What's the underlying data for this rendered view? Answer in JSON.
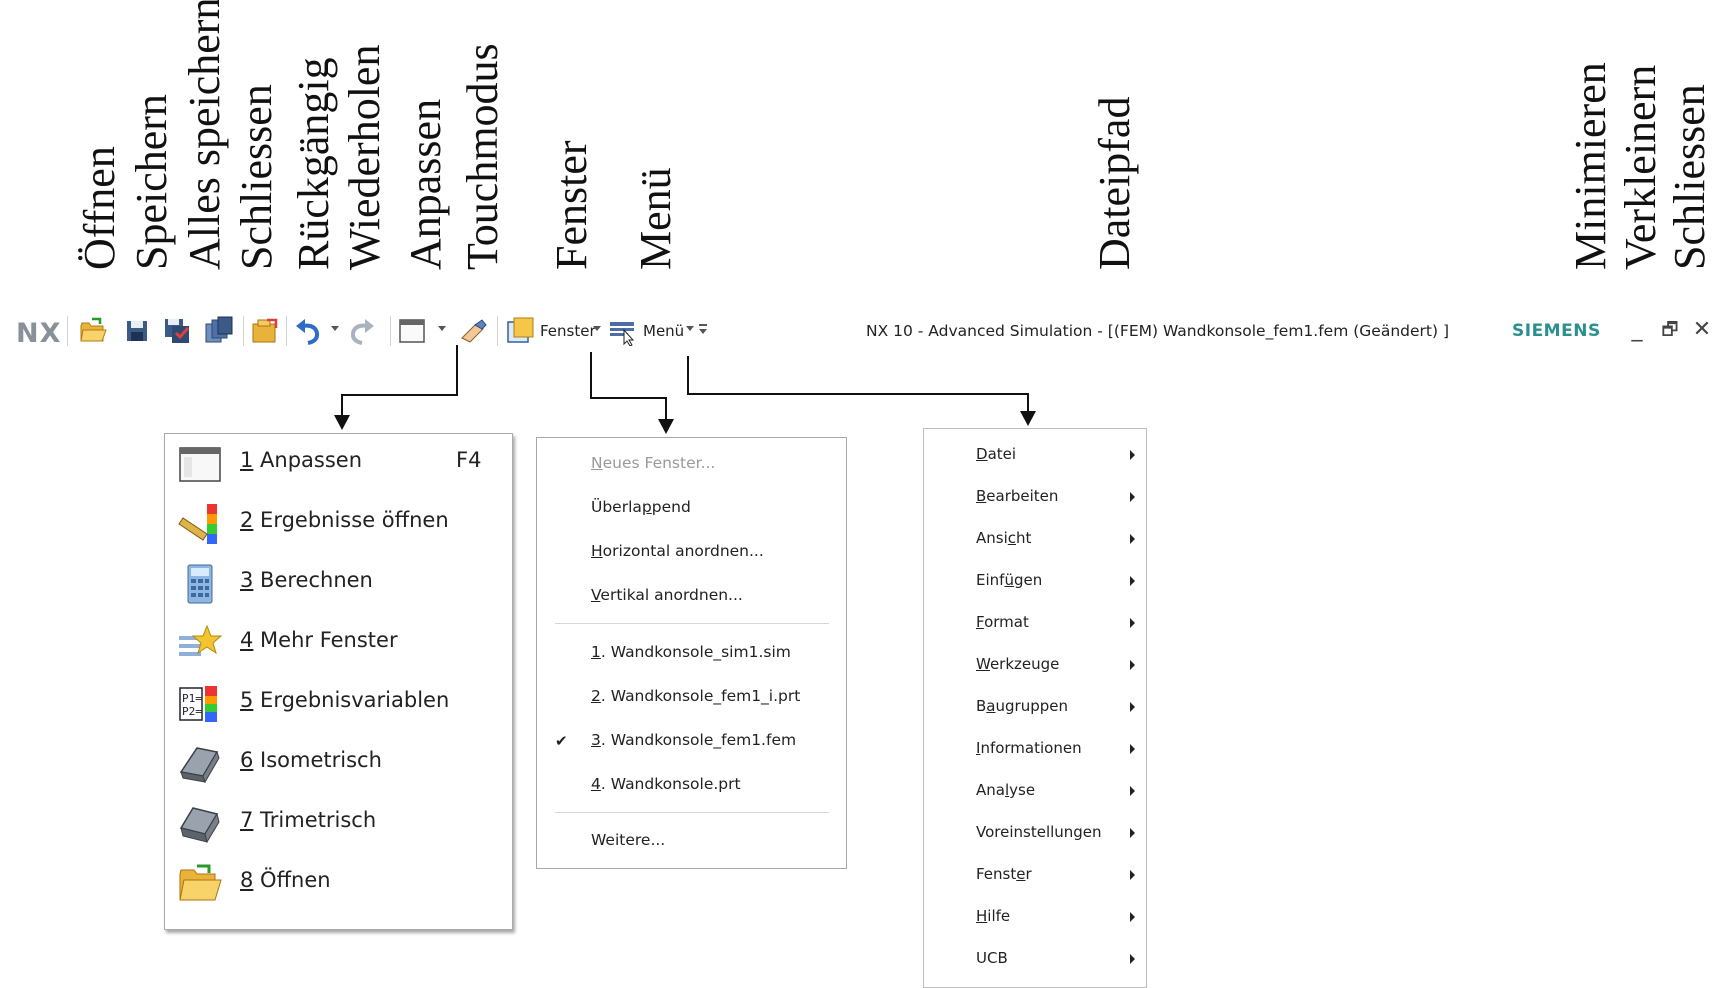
{
  "annotations": [
    {
      "key": "oeffnen",
      "text": "Öffnen"
    },
    {
      "key": "speichern",
      "text": "Speichern"
    },
    {
      "key": "alles-speichern",
      "text": "Alles speichern"
    },
    {
      "key": "schliessen-file",
      "text": "Schliessen"
    },
    {
      "key": "rueckgaengig",
      "text": "Rückgängig"
    },
    {
      "key": "wiederholen",
      "text": "Wiederholen"
    },
    {
      "key": "anpassen",
      "text": "Anpassen"
    },
    {
      "key": "touchmodus",
      "text": "Touchmodus"
    },
    {
      "key": "fenster",
      "text": "Fenster"
    },
    {
      "key": "menue",
      "text": "Menü"
    },
    {
      "key": "dateipfad",
      "text": "Dateipfad"
    },
    {
      "key": "minimieren",
      "text": "Minimieren"
    },
    {
      "key": "verkleinern",
      "text": "Verkleinern"
    },
    {
      "key": "schliessen-window",
      "text": "Schliessen"
    }
  ],
  "toolbar": {
    "logo": "NX",
    "fenster_label": "Fenster",
    "menu_label": "Menü",
    "title": "NX 10 - Advanced Simulation - [(FEM) Wandkonsole_fem1.fem (Geändert) ]",
    "brand": "SIEMENS",
    "minimize_glyph": "_",
    "restore_glyph": "🗗",
    "close_glyph": "✕"
  },
  "anpassen_menu": {
    "items": [
      {
        "num": "1",
        "label": " Anpassen",
        "shortcut": "F4",
        "icon": "window-icon"
      },
      {
        "num": "2",
        "label": " Ergebnisse öffnen",
        "shortcut": "",
        "icon": "results-icon"
      },
      {
        "num": "3",
        "label": " Berechnen",
        "shortcut": "",
        "icon": "calculator-icon"
      },
      {
        "num": "4",
        "label": " Mehr Fenster",
        "shortcut": "",
        "icon": "more-windows-icon"
      },
      {
        "num": "5",
        "label": " Ergebnisvariablen",
        "shortcut": "",
        "icon": "result-variables-icon"
      },
      {
        "num": "6",
        "label": " Isometrisch",
        "shortcut": "",
        "icon": "isometric-icon"
      },
      {
        "num": "7",
        "label": " Trimetrisch",
        "shortcut": "",
        "icon": "trimetric-icon"
      },
      {
        "num": "8",
        "label": " Öffnen",
        "shortcut": "",
        "icon": "open-folder-icon"
      }
    ]
  },
  "fenster_menu": {
    "neues_fenster": {
      "u": "N",
      "rest": "eues Fenster..."
    },
    "ueberlappend": {
      "pre": "Überla",
      "u": "p",
      "rest": "pend"
    },
    "horizontal": {
      "u": "H",
      "rest": "orizontal anordnen..."
    },
    "vertikal": {
      "u": "V",
      "rest": "ertikal anordnen..."
    },
    "files": [
      {
        "u": "1",
        "rest": ". Wandkonsole_sim1.sim"
      },
      {
        "u": "2",
        "rest": ". Wandkonsole_fem1_i.prt"
      },
      {
        "u": "3",
        "rest": ". Wandkonsole_fem1.fem"
      },
      {
        "u": "4",
        "rest": ". Wandkonsole.prt"
      }
    ],
    "check": "✔",
    "weitere": "Weitere..."
  },
  "menu_menu": {
    "items": [
      {
        "pre": "",
        "u": "D",
        "rest": "atei"
      },
      {
        "pre": "",
        "u": "B",
        "rest": "earbeiten"
      },
      {
        "pre": "Ansi",
        "u": "c",
        "rest": "ht"
      },
      {
        "pre": "Einf",
        "u": "ü",
        "rest": "gen"
      },
      {
        "pre": "",
        "u": "F",
        "rest": "ormat"
      },
      {
        "pre": "",
        "u": "W",
        "rest": "erkzeuge"
      },
      {
        "pre": "B",
        "u": "a",
        "rest": "ugruppen"
      },
      {
        "pre": "",
        "u": "I",
        "rest": "nformationen"
      },
      {
        "pre": "Ana",
        "u": "l",
        "rest": "yse"
      },
      {
        "pre": "Voreinstellungen",
        "u": "",
        "rest": ""
      },
      {
        "pre": "Fenst",
        "u": "e",
        "rest": "r"
      },
      {
        "pre": "",
        "u": "H",
        "rest": "ilfe"
      },
      {
        "pre": "UCB",
        "u": "",
        "rest": ""
      }
    ]
  }
}
